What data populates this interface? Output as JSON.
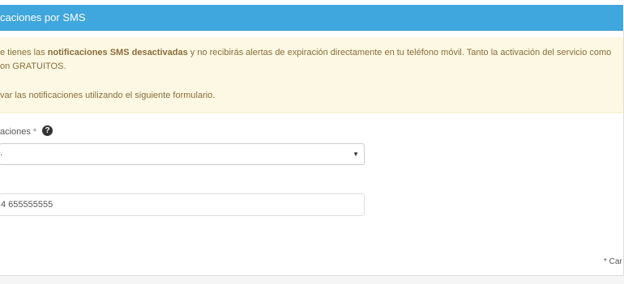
{
  "panel": {
    "title": "caciones por SMS"
  },
  "alert": {
    "line1_pre": "e tienes las ",
    "line1_bold": "notificaciones SMS desactivadas",
    "line1_post": " y no recibirás alertas de expiración directamente en tu teléfono móvil. Tanto la activación del servicio como",
    "line2": "on GRATUITOS.",
    "line3": "var las notificaciones utilizando el siguiente formulario."
  },
  "form": {
    "notifications_label": "aciones",
    "required_mark": "*",
    "help_icon_glyph": "?",
    "select_value": ".",
    "select_caret": "▼",
    "phone_value": "4 655555555",
    "required_note": "* Car"
  },
  "colors": {
    "header": "#3fa6de",
    "alert_bg": "#fcf8e3",
    "alert_text": "#8a6d3b"
  },
  "icons": {
    "help": "question-circle-icon",
    "caret": "caret-down-icon"
  }
}
